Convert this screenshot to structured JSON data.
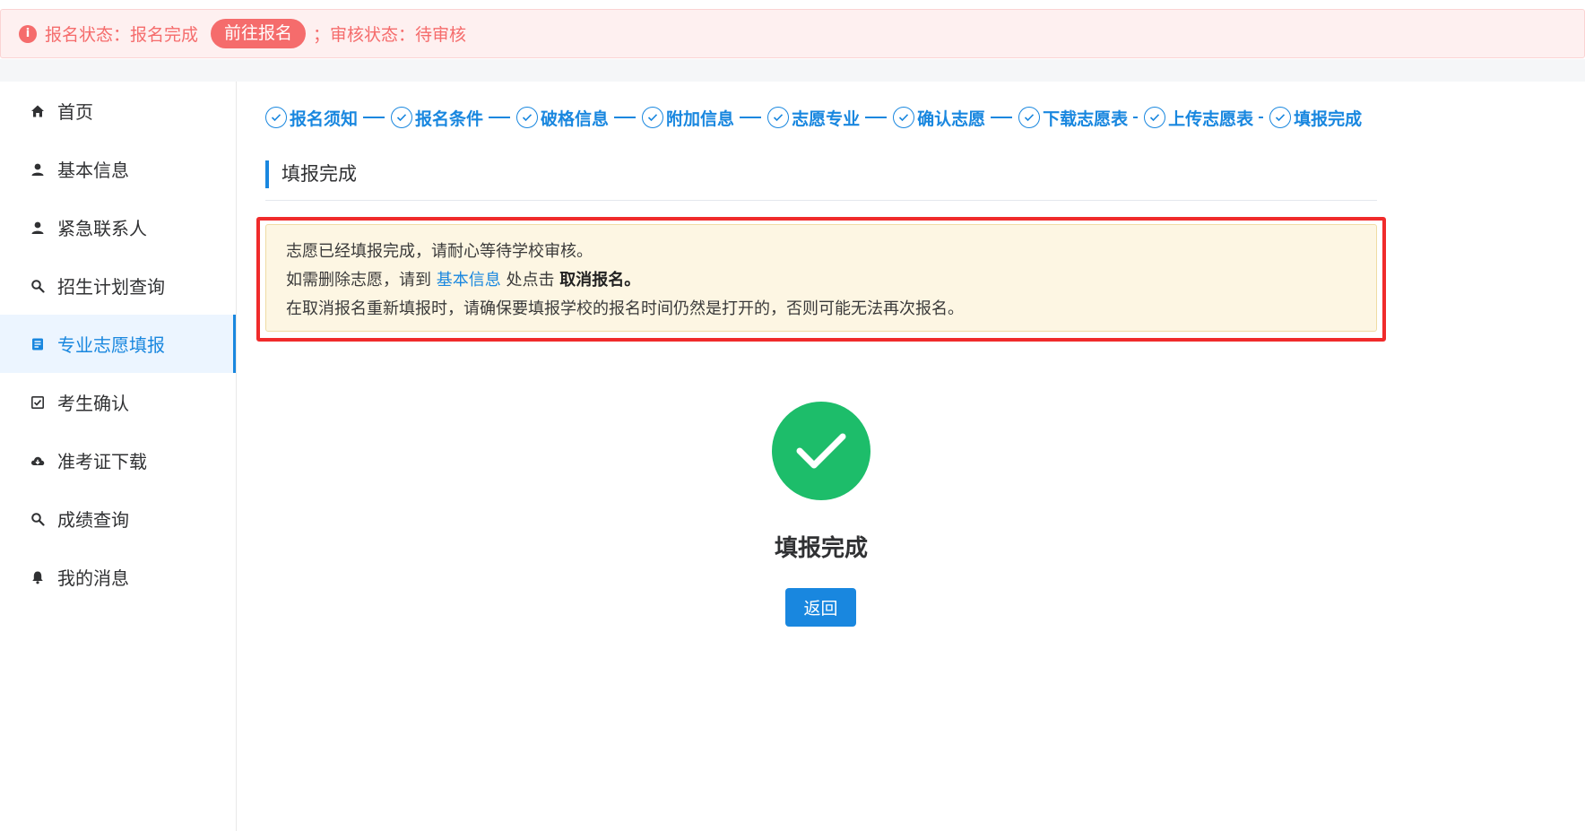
{
  "top_alert": {
    "status_text": "报名状态：报名完成",
    "goto_button": "前往报名",
    "review_text": "；审核状态：待审核"
  },
  "sidebar": {
    "items": [
      {
        "label": "首页",
        "icon": "home-icon"
      },
      {
        "label": "基本信息",
        "icon": "user-icon"
      },
      {
        "label": "紧急联系人",
        "icon": "user-icon"
      },
      {
        "label": "招生计划查询",
        "icon": "search-icon"
      },
      {
        "label": "专业志愿填报",
        "icon": "document-icon",
        "active": true
      },
      {
        "label": "考生确认",
        "icon": "checkbox-icon"
      },
      {
        "label": "准考证下载",
        "icon": "cloud-download-icon"
      },
      {
        "label": "成绩查询",
        "icon": "search-icon"
      },
      {
        "label": "我的消息",
        "icon": "bell-icon"
      }
    ]
  },
  "steps": [
    {
      "label": "报名须知"
    },
    {
      "label": "报名条件"
    },
    {
      "label": "破格信息"
    },
    {
      "label": "附加信息"
    },
    {
      "label": "志愿专业"
    },
    {
      "label": "确认志愿"
    },
    {
      "label": "下载志愿表"
    },
    {
      "label": "上传志愿表"
    },
    {
      "label": "填报完成"
    }
  ],
  "section_title": "填报完成",
  "notice": {
    "line1": "志愿已经填报完成，请耐心等待学校审核。",
    "line2_prefix": "如需删除志愿，请到",
    "line2_link": "基本信息",
    "line2_middle": "处点击",
    "line2_bold": "取消报名。",
    "line3": "在取消报名重新填报时，请确保要填报学校的报名时间仍然是打开的，否则可能无法再次报名。"
  },
  "result": {
    "title": "填报完成",
    "back_button": "返回"
  },
  "colors": {
    "primary": "#1987df",
    "danger": "#f56c6c",
    "success": "#1dbd6a",
    "highlight_frame": "#f02b2b"
  }
}
